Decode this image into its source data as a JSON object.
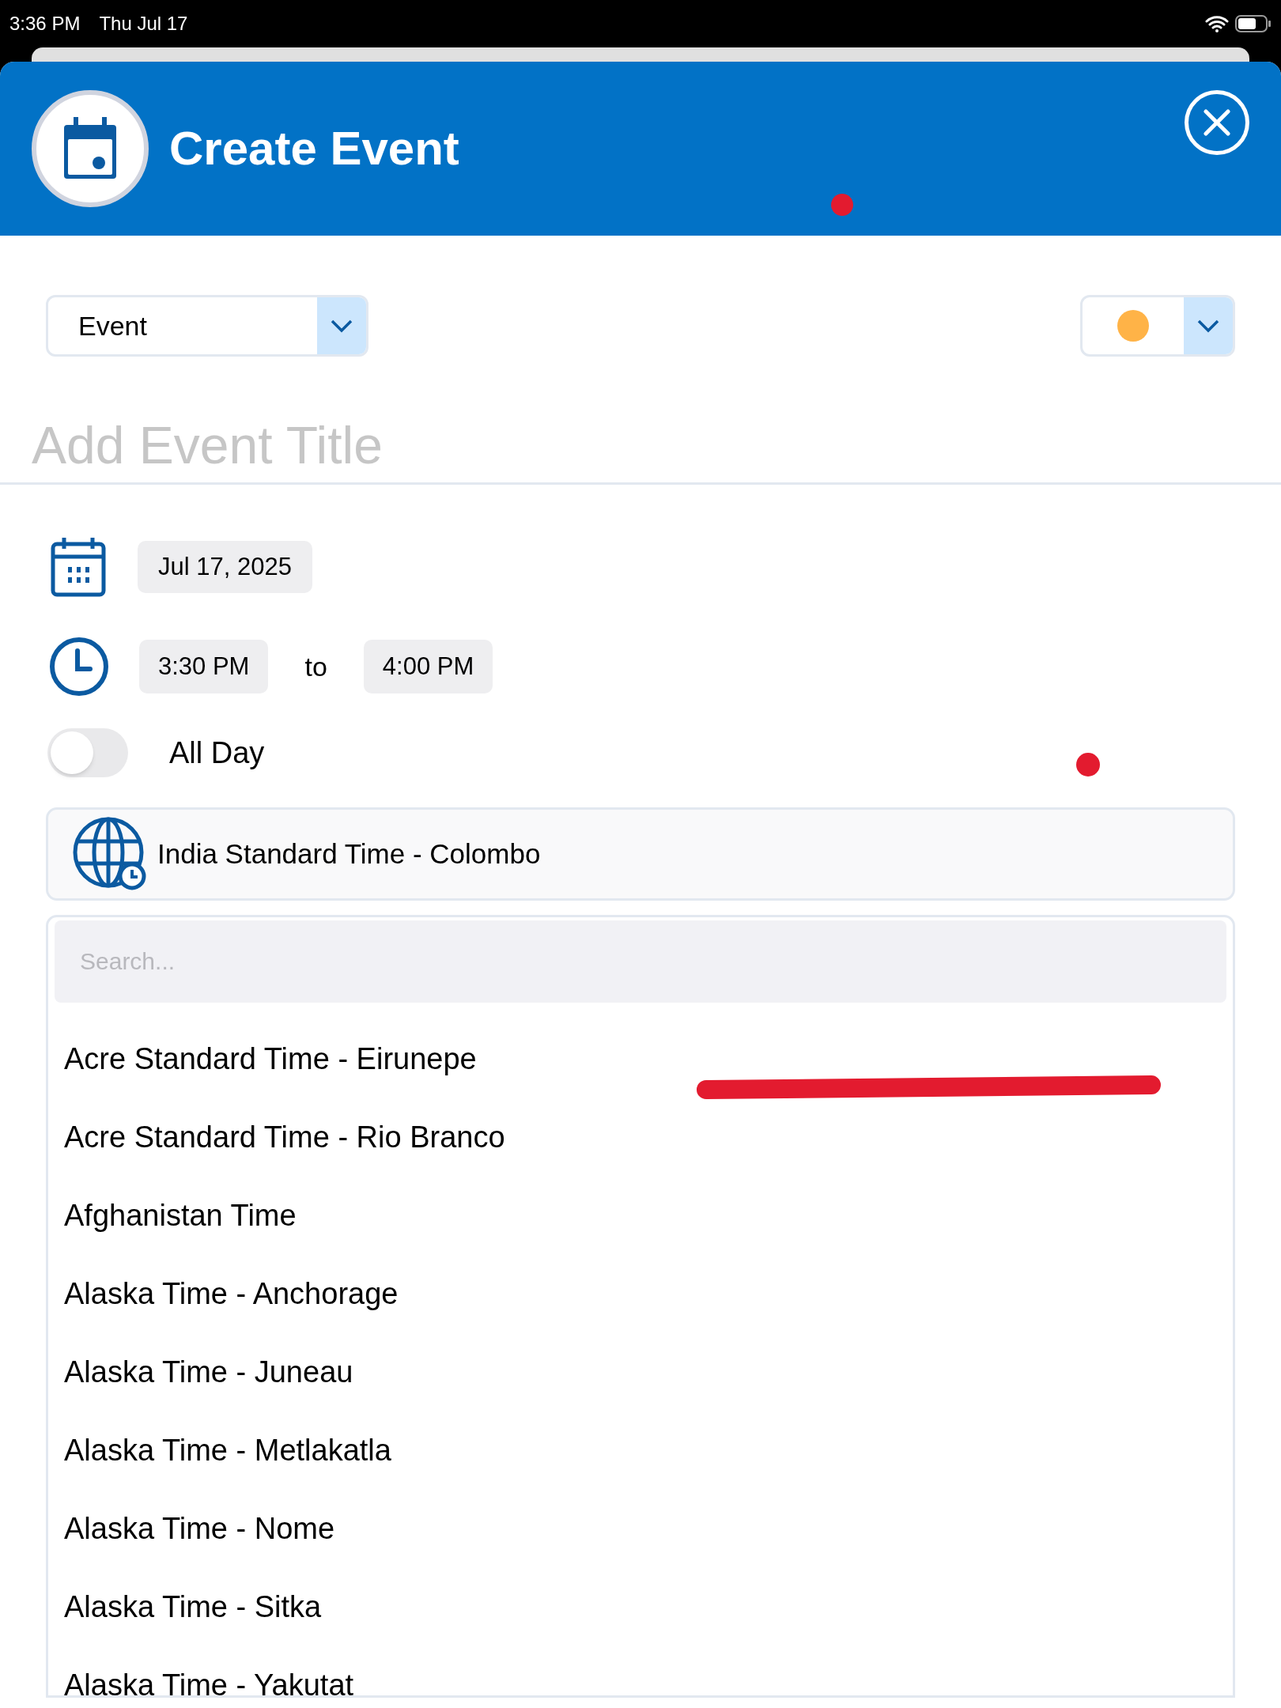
{
  "status_bar": {
    "time": "3:36 PM",
    "date": "Thu Jul 17"
  },
  "header": {
    "title": "Create Event"
  },
  "event_type": {
    "value": "Event"
  },
  "event_color": {
    "color": "#ffb347"
  },
  "title_field": {
    "placeholder": "Add Event Title"
  },
  "date": {
    "value": "Jul 17, 2025"
  },
  "time": {
    "start": "3:30 PM",
    "separator": "to",
    "end": "4:00 PM"
  },
  "all_day": {
    "label": "All Day",
    "on": false
  },
  "timezone": {
    "value": "India Standard Time - Colombo"
  },
  "timezone_list": {
    "search_placeholder": "Search...",
    "items": [
      {
        "label": "Acre Standard Time - Eirunepe"
      },
      {
        "label": "Acre Standard Time - Rio Branco"
      },
      {
        "label": "Afghanistan Time"
      },
      {
        "label": "Alaska Time - Anchorage"
      },
      {
        "label": "Alaska Time - Juneau"
      },
      {
        "label": "Alaska Time - Metlakatla"
      },
      {
        "label": "Alaska Time - Nome"
      },
      {
        "label": "Alaska Time - Sitka"
      },
      {
        "label": "Alaska Time - Yakutat"
      }
    ]
  }
}
